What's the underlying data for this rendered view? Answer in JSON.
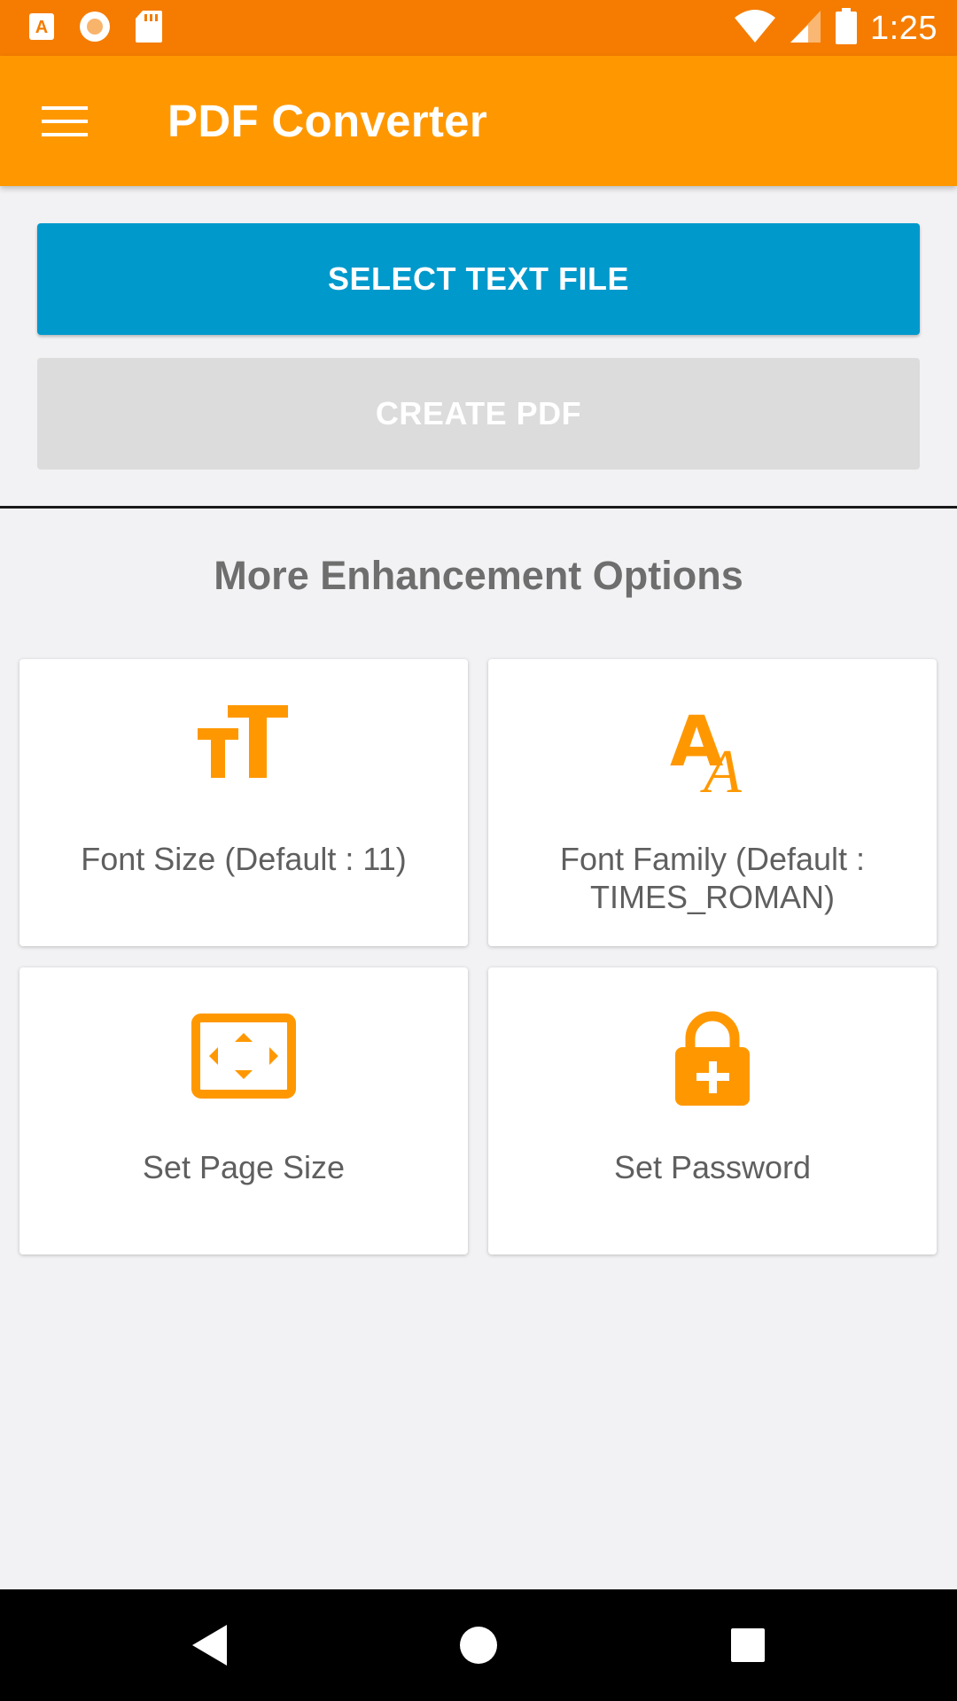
{
  "status_bar": {
    "time": "1:25",
    "icons": [
      "app-a-icon",
      "record-icon",
      "sd-card-icon",
      "wifi-icon",
      "cell-signal-icon",
      "battery-icon"
    ]
  },
  "app_bar": {
    "title": "PDF Converter",
    "menu_icon": "hamburger-menu-icon"
  },
  "actions": {
    "select_label": "SELECT TEXT FILE",
    "create_label": "CREATE PDF"
  },
  "enhancements": {
    "title": "More Enhancement Options",
    "items": [
      {
        "label": "Font Size (Default : 11)",
        "icon": "font-size-icon"
      },
      {
        "label": "Font Family (Default : TIMES_ROMAN)",
        "icon": "font-family-icon"
      },
      {
        "label": "Set Page Size",
        "icon": "page-size-icon"
      },
      {
        "label": "Set Password",
        "icon": "lock-add-icon"
      }
    ]
  },
  "nav": {
    "icons": [
      "back-icon",
      "home-icon",
      "recents-icon"
    ]
  },
  "colors": {
    "status_bar": "#f57c00",
    "app_bar": "#ff9800",
    "primary_button": "#0099cc",
    "disabled_button": "#dcdcdc",
    "accent_icon": "#ff9800",
    "background": "#f2f2f4"
  }
}
